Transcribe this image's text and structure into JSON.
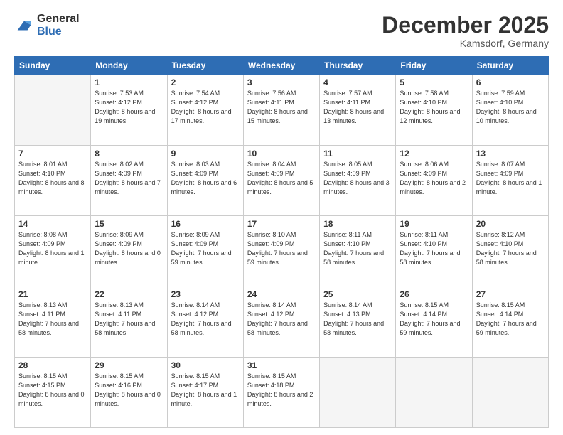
{
  "header": {
    "logo": {
      "general": "General",
      "blue": "Blue"
    },
    "title": "December 2025",
    "location": "Kamsdorf, Germany"
  },
  "weekdays": [
    "Sunday",
    "Monday",
    "Tuesday",
    "Wednesday",
    "Thursday",
    "Friday",
    "Saturday"
  ],
  "weeks": [
    [
      {
        "day": null,
        "sunrise": null,
        "sunset": null,
        "daylight": null
      },
      {
        "day": 1,
        "sunrise": "7:53 AM",
        "sunset": "4:12 PM",
        "daylight": "8 hours and 19 minutes."
      },
      {
        "day": 2,
        "sunrise": "7:54 AM",
        "sunset": "4:12 PM",
        "daylight": "8 hours and 17 minutes."
      },
      {
        "day": 3,
        "sunrise": "7:56 AM",
        "sunset": "4:11 PM",
        "daylight": "8 hours and 15 minutes."
      },
      {
        "day": 4,
        "sunrise": "7:57 AM",
        "sunset": "4:11 PM",
        "daylight": "8 hours and 13 minutes."
      },
      {
        "day": 5,
        "sunrise": "7:58 AM",
        "sunset": "4:10 PM",
        "daylight": "8 hours and 12 minutes."
      },
      {
        "day": 6,
        "sunrise": "7:59 AM",
        "sunset": "4:10 PM",
        "daylight": "8 hours and 10 minutes."
      }
    ],
    [
      {
        "day": 7,
        "sunrise": "8:01 AM",
        "sunset": "4:10 PM",
        "daylight": "8 hours and 8 minutes."
      },
      {
        "day": 8,
        "sunrise": "8:02 AM",
        "sunset": "4:09 PM",
        "daylight": "8 hours and 7 minutes."
      },
      {
        "day": 9,
        "sunrise": "8:03 AM",
        "sunset": "4:09 PM",
        "daylight": "8 hours and 6 minutes."
      },
      {
        "day": 10,
        "sunrise": "8:04 AM",
        "sunset": "4:09 PM",
        "daylight": "8 hours and 5 minutes."
      },
      {
        "day": 11,
        "sunrise": "8:05 AM",
        "sunset": "4:09 PM",
        "daylight": "8 hours and 3 minutes."
      },
      {
        "day": 12,
        "sunrise": "8:06 AM",
        "sunset": "4:09 PM",
        "daylight": "8 hours and 2 minutes."
      },
      {
        "day": 13,
        "sunrise": "8:07 AM",
        "sunset": "4:09 PM",
        "daylight": "8 hours and 1 minute."
      }
    ],
    [
      {
        "day": 14,
        "sunrise": "8:08 AM",
        "sunset": "4:09 PM",
        "daylight": "8 hours and 1 minute."
      },
      {
        "day": 15,
        "sunrise": "8:09 AM",
        "sunset": "4:09 PM",
        "daylight": "8 hours and 0 minutes."
      },
      {
        "day": 16,
        "sunrise": "8:09 AM",
        "sunset": "4:09 PM",
        "daylight": "7 hours and 59 minutes."
      },
      {
        "day": 17,
        "sunrise": "8:10 AM",
        "sunset": "4:09 PM",
        "daylight": "7 hours and 59 minutes."
      },
      {
        "day": 18,
        "sunrise": "8:11 AM",
        "sunset": "4:10 PM",
        "daylight": "7 hours and 58 minutes."
      },
      {
        "day": 19,
        "sunrise": "8:11 AM",
        "sunset": "4:10 PM",
        "daylight": "7 hours and 58 minutes."
      },
      {
        "day": 20,
        "sunrise": "8:12 AM",
        "sunset": "4:10 PM",
        "daylight": "7 hours and 58 minutes."
      }
    ],
    [
      {
        "day": 21,
        "sunrise": "8:13 AM",
        "sunset": "4:11 PM",
        "daylight": "7 hours and 58 minutes."
      },
      {
        "day": 22,
        "sunrise": "8:13 AM",
        "sunset": "4:11 PM",
        "daylight": "7 hours and 58 minutes."
      },
      {
        "day": 23,
        "sunrise": "8:14 AM",
        "sunset": "4:12 PM",
        "daylight": "7 hours and 58 minutes."
      },
      {
        "day": 24,
        "sunrise": "8:14 AM",
        "sunset": "4:12 PM",
        "daylight": "7 hours and 58 minutes."
      },
      {
        "day": 25,
        "sunrise": "8:14 AM",
        "sunset": "4:13 PM",
        "daylight": "7 hours and 58 minutes."
      },
      {
        "day": 26,
        "sunrise": "8:15 AM",
        "sunset": "4:14 PM",
        "daylight": "7 hours and 59 minutes."
      },
      {
        "day": 27,
        "sunrise": "8:15 AM",
        "sunset": "4:14 PM",
        "daylight": "7 hours and 59 minutes."
      }
    ],
    [
      {
        "day": 28,
        "sunrise": "8:15 AM",
        "sunset": "4:15 PM",
        "daylight": "8 hours and 0 minutes."
      },
      {
        "day": 29,
        "sunrise": "8:15 AM",
        "sunset": "4:16 PM",
        "daylight": "8 hours and 0 minutes."
      },
      {
        "day": 30,
        "sunrise": "8:15 AM",
        "sunset": "4:17 PM",
        "daylight": "8 hours and 1 minute."
      },
      {
        "day": 31,
        "sunrise": "8:15 AM",
        "sunset": "4:18 PM",
        "daylight": "8 hours and 2 minutes."
      },
      {
        "day": null,
        "sunrise": null,
        "sunset": null,
        "daylight": null
      },
      {
        "day": null,
        "sunrise": null,
        "sunset": null,
        "daylight": null
      },
      {
        "day": null,
        "sunrise": null,
        "sunset": null,
        "daylight": null
      }
    ]
  ]
}
